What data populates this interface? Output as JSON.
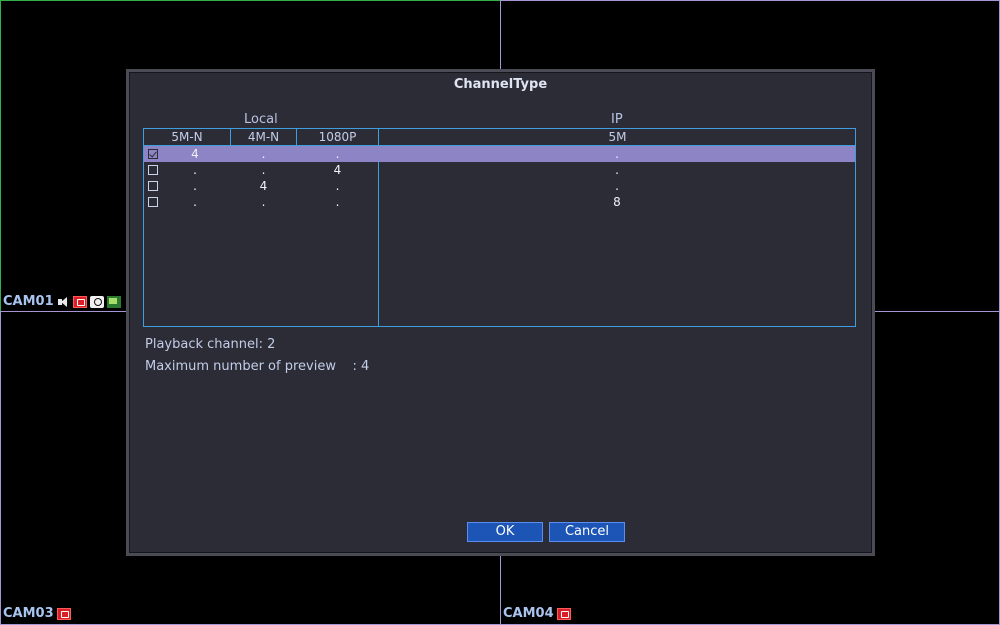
{
  "cameras": [
    {
      "label": "CAM01",
      "icons": [
        "speaker-icon",
        "record-alert-icon",
        "snapshot-icon",
        "recording-icon"
      ]
    },
    {
      "label": ""
    },
    {
      "label": "CAM03",
      "icons": [
        "record-alert-icon"
      ]
    },
    {
      "label": "CAM04",
      "icons": [
        "record-alert-icon"
      ]
    }
  ],
  "dialog": {
    "title": "ChannelType",
    "local_header": "Local",
    "ip_header": "IP",
    "columns": [
      "5M-N",
      "4M-N",
      "1080P",
      "5M"
    ],
    "rows": [
      {
        "checked": true,
        "selected": true,
        "values": [
          "4",
          ".",
          ".",
          "."
        ]
      },
      {
        "checked": false,
        "selected": false,
        "values": [
          ".",
          ".",
          "4",
          "."
        ]
      },
      {
        "checked": false,
        "selected": false,
        "values": [
          ".",
          "4",
          ".",
          "."
        ]
      },
      {
        "checked": false,
        "selected": false,
        "values": [
          ".",
          ".",
          ".",
          "8"
        ]
      }
    ],
    "playback_channel": "Playback channel: 2",
    "max_preview": "Maximum number of preview    : 4",
    "ok_label": "OK",
    "cancel_label": "Cancel"
  },
  "colors": {
    "active_border": "#2fb04a",
    "tile_border": "#a695d3",
    "selected_row": "#8d84c5",
    "table_border": "#3e9ee0",
    "button": "#1c55b6"
  }
}
